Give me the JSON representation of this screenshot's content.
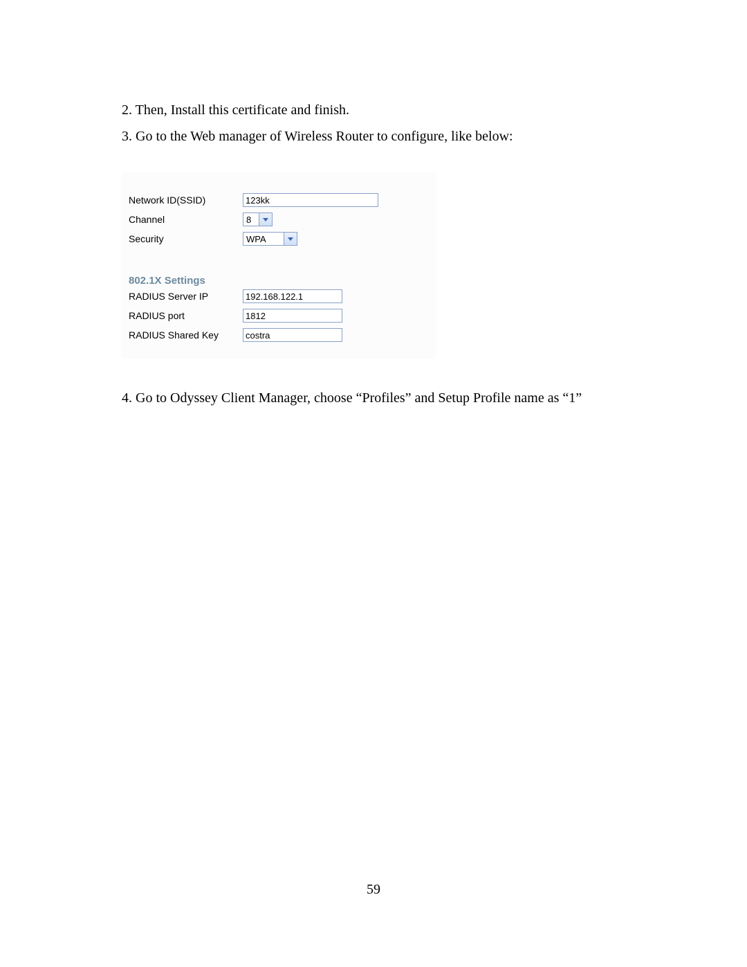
{
  "steps": {
    "s2": "2. Then, Install this certificate and finish.",
    "s3": "3. Go to the Web manager of Wireless Router to configure, like below:",
    "s4": "4. Go to Odyssey Client Manager, choose “Profiles” and Setup Profile name as “1”"
  },
  "form": {
    "ssid_label": "Network ID(SSID)",
    "ssid_value": "123kk",
    "channel_label": "Channel",
    "channel_value": "8",
    "security_label": "Security",
    "security_value": "WPA",
    "section_title": "802.1X Settings",
    "radius_ip_label": "RADIUS Server IP",
    "radius_ip_value": "192.168.122.1",
    "radius_port_label": "RADIUS port",
    "radius_port_value": "1812",
    "radius_key_label": "RADIUS Shared Key",
    "radius_key_value": "costra"
  },
  "page_number": "59"
}
